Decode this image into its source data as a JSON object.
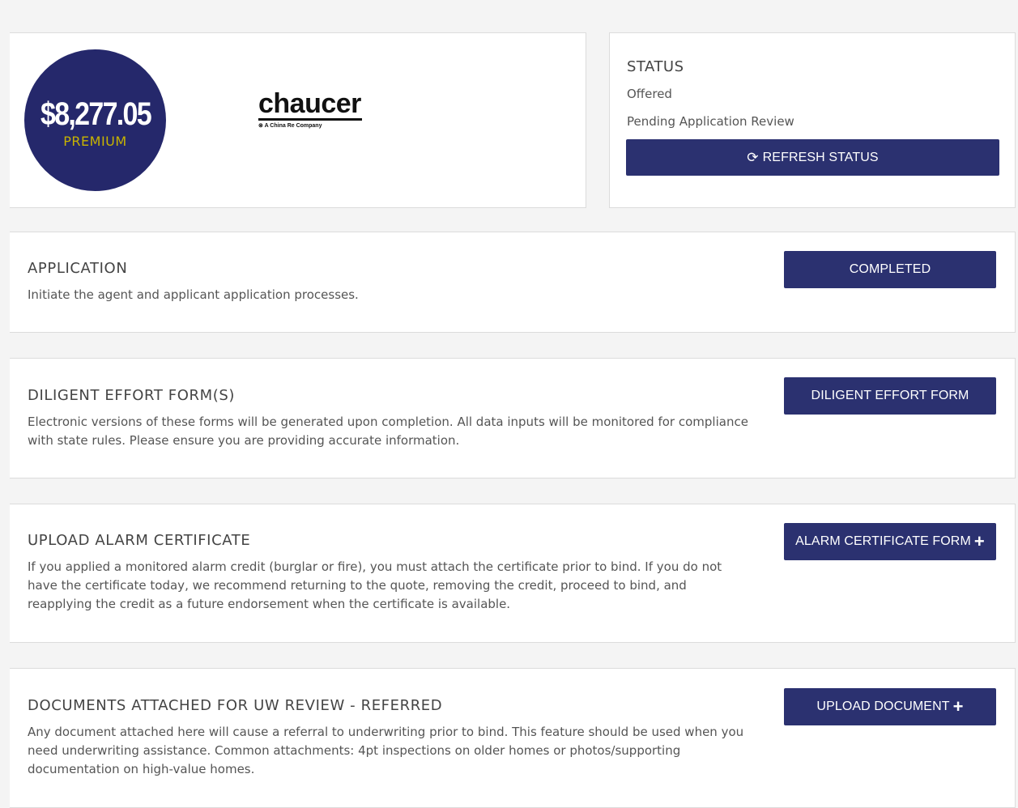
{
  "premium": {
    "amount": "$8,277.05",
    "label": "PREMIUM"
  },
  "carrier_logo": {
    "name": "chaucer",
    "tagline": "A China Re Company"
  },
  "status": {
    "title": "STATUS",
    "state": "Offered",
    "detail": "Pending Application Review",
    "refresh_label": "REFRESH STATUS",
    "refresh_icon": "refresh-icon"
  },
  "sections": [
    {
      "title": "APPLICATION",
      "description": "Initiate the agent and applicant application processes.",
      "button_label": "COMPLETED"
    },
    {
      "title": "DILIGENT EFFORT FORM(S)",
      "description": "Electronic versions of these forms will be generated upon completion. All data inputs will be monitored for compliance with state rules. Please ensure you are providing accurate information.",
      "button_label": "DILIGENT EFFORT FORM"
    },
    {
      "title": "UPLOAD ALARM CERTIFICATE",
      "description": "If you applied a monitored alarm credit (burglar or fire), you must attach the certificate prior to bind. If you do not have the certificate today, we recommend returning to the quote, removing the credit, proceed to bind, and reapplying the credit as a future endorsement when the certificate is available.",
      "button_label": "ALARM CERTIFICATE FORM",
      "button_icon": "plus-icon"
    },
    {
      "title": "DOCUMENTS ATTACHED FOR UW REVIEW - REFERRED",
      "description": "Any document attached here will cause a referral to underwriting prior to bind. This feature should be used when you need underwriting assistance. Common attachments: 4pt inspections on older homes or photos/supporting documentation on high-value homes.",
      "button_label": "UPLOAD DOCUMENT",
      "button_icon": "plus-icon"
    }
  ],
  "colors": {
    "primary": "#2b3170",
    "premium_circle": "#25286b",
    "premium_label": "#c8b400",
    "background": "#f4f4f4"
  }
}
